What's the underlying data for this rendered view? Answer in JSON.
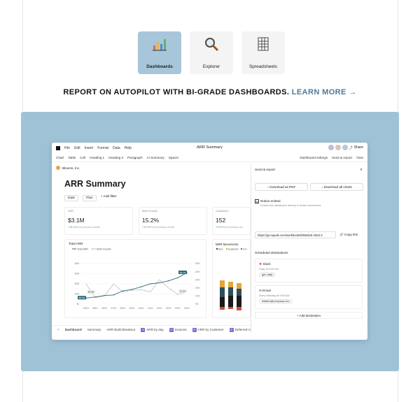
{
  "tiles": [
    {
      "label": "Dashboards",
      "icon": "bar-chart-icon",
      "active": true
    },
    {
      "label": "Explorer",
      "icon": "magnifier-icon",
      "active": false
    },
    {
      "label": "Spreadsheets",
      "icon": "spreadsheet-icon",
      "active": false
    }
  ],
  "headline": {
    "text": "REPORT ON AUTOPILOT WITH BI-GRADE DASHBOARDS.",
    "link": "LEARN MORE →"
  },
  "app": {
    "title": "ARR Summary",
    "menu": [
      "File",
      "Edit",
      "Insert",
      "Format",
      "Data",
      "Help"
    ],
    "share": "Share",
    "toolbar": [
      "Chart",
      "Table",
      "Cell",
      "Heading 1",
      "Heading 2",
      "Paragraph",
      "AI Summary",
      "Spacer"
    ],
    "toolbar_right": [
      "Dashboard settings",
      "Send & export",
      "View"
    ],
    "company": "Blooms, Inc.",
    "page_title": "ARR Summary",
    "filters": [
      "Date",
      "Plan",
      "+ Add filter"
    ],
    "cards": [
      {
        "label": "ARR",
        "value": "$3.1M",
        "delta": "+16.2%",
        "rest": "from previous month"
      },
      {
        "label": "MoM Growth",
        "value": "15.2%",
        "delta": "+10.9%",
        "rest": "from previous month"
      },
      {
        "label": "Customers",
        "value": "152",
        "delta": "+3.4%",
        "rest": "from previous mo"
      }
    ],
    "total_arr": {
      "title": "Total ARR",
      "legend": [
        "Total ARR",
        "MoM Growth"
      ]
    },
    "mrr": {
      "title": "MRR Movements",
      "legend": [
        "New",
        "Expansion",
        "Con"
      ]
    },
    "tabs": [
      "Dashboard",
      "Summary",
      "ARR Build Breakout",
      "ARR by day",
      "Invoices",
      "ARR by Customer",
      "Deferred ARR"
    ],
    "zoom": "100%"
  },
  "modal": {
    "title": "Send & export",
    "btn_pdf": "Download as PDF",
    "btn_charts": "Download all charts",
    "notion_title": "Notion embed",
    "notion_sub": "Embed live dashboard directly in Notion documents",
    "url": "https://go.equals.com/workbooks/d93abc5-1553-4",
    "copy": "Copy link",
    "scheduled": "Scheduled destinations",
    "slack": {
      "title": "Slack",
      "sub": "Daily at 9:00 AM",
      "pill": "gen-daily"
    },
    "email": {
      "title": "Email",
      "sub": "Every Monday at 9:00 AM",
      "pill": "leaders@company.com"
    },
    "add": "+ Add destination"
  },
  "chart_data": {
    "type": "line",
    "title": "Total ARR",
    "x": [
      "04/01",
      "05/01",
      "06/01",
      "07/01",
      "08/01",
      "09/01",
      "10/01",
      "11/01",
      "12/01",
      "01/01",
      "02/01",
      "03/01"
    ],
    "series": [
      {
        "name": "Total ARR",
        "values": [
          0.6,
          0.7,
          0.85,
          0.9,
          1.3,
          1.45,
          1.7,
          2.0,
          2.1,
          2.3,
          2.6,
          3.1
        ]
      },
      {
        "name": "MoM Growth",
        "values": [
          25,
          8,
          10,
          25,
          15,
          17,
          18,
          15,
          30,
          20,
          12,
          15
        ]
      }
    ],
    "y_left_ticks": [
      "$4M",
      "$3M",
      "$2M",
      "$1M",
      "$0"
    ],
    "y_right_ticks": [
      "50%",
      "40%",
      "30%",
      "20%",
      "10%",
      "0%"
    ],
    "data_labels": [
      "$0.5M",
      "$3.1M",
      "$0.6M",
      "15.2%"
    ]
  },
  "colors": {
    "panel": "#9fc2d7",
    "arr": "#2f6b7a",
    "growth": "#888888",
    "accent": "#4f7a95"
  }
}
